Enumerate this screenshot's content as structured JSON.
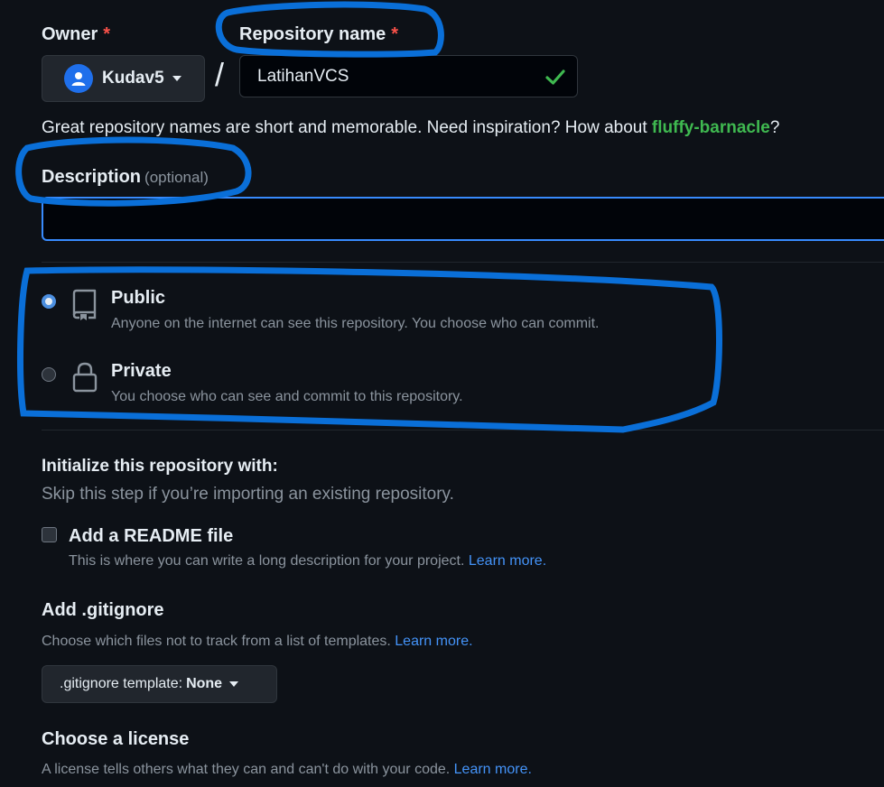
{
  "owner": {
    "label": "Owner",
    "required_mark": "*",
    "selected": "Kudav5"
  },
  "repository": {
    "label": "Repository name",
    "required_mark": "*",
    "separator": "/",
    "value": "LatihanVCS",
    "hint_prefix": "Great repository names are short and memorable. Need inspiration? How about ",
    "suggestion": "fluffy-barnacle",
    "hint_suffix": "?"
  },
  "description": {
    "label": "Description",
    "optional": "(optional)",
    "value": ""
  },
  "visibility": {
    "public": {
      "title": "Public",
      "desc": "Anyone on the internet can see this repository. You choose who can commit.",
      "selected": true
    },
    "private": {
      "title": "Private",
      "desc": "You choose who can see and commit to this repository.",
      "selected": false
    }
  },
  "initialize": {
    "title": "Initialize this repository with:",
    "subtitle": "Skip this step if you’re importing an existing repository.",
    "readme": {
      "label": "Add a README file",
      "desc": "This is where you can write a long description for your project.",
      "link": "Learn more.",
      "checked": false
    }
  },
  "gitignore": {
    "title": "Add .gitignore",
    "desc": "Choose which files not to track from a list of templates.",
    "link": "Learn more.",
    "button_label": ".gitignore template:",
    "button_value": "None"
  },
  "license": {
    "title": "Choose a license",
    "desc": "A license tells others what they can and can't do with your code.",
    "link": "Learn more."
  },
  "colors": {
    "background": "#0d1117",
    "accent": "#4493f8",
    "success": "#3fb950",
    "required": "#f85149",
    "annotation": "#0a6fd8"
  }
}
